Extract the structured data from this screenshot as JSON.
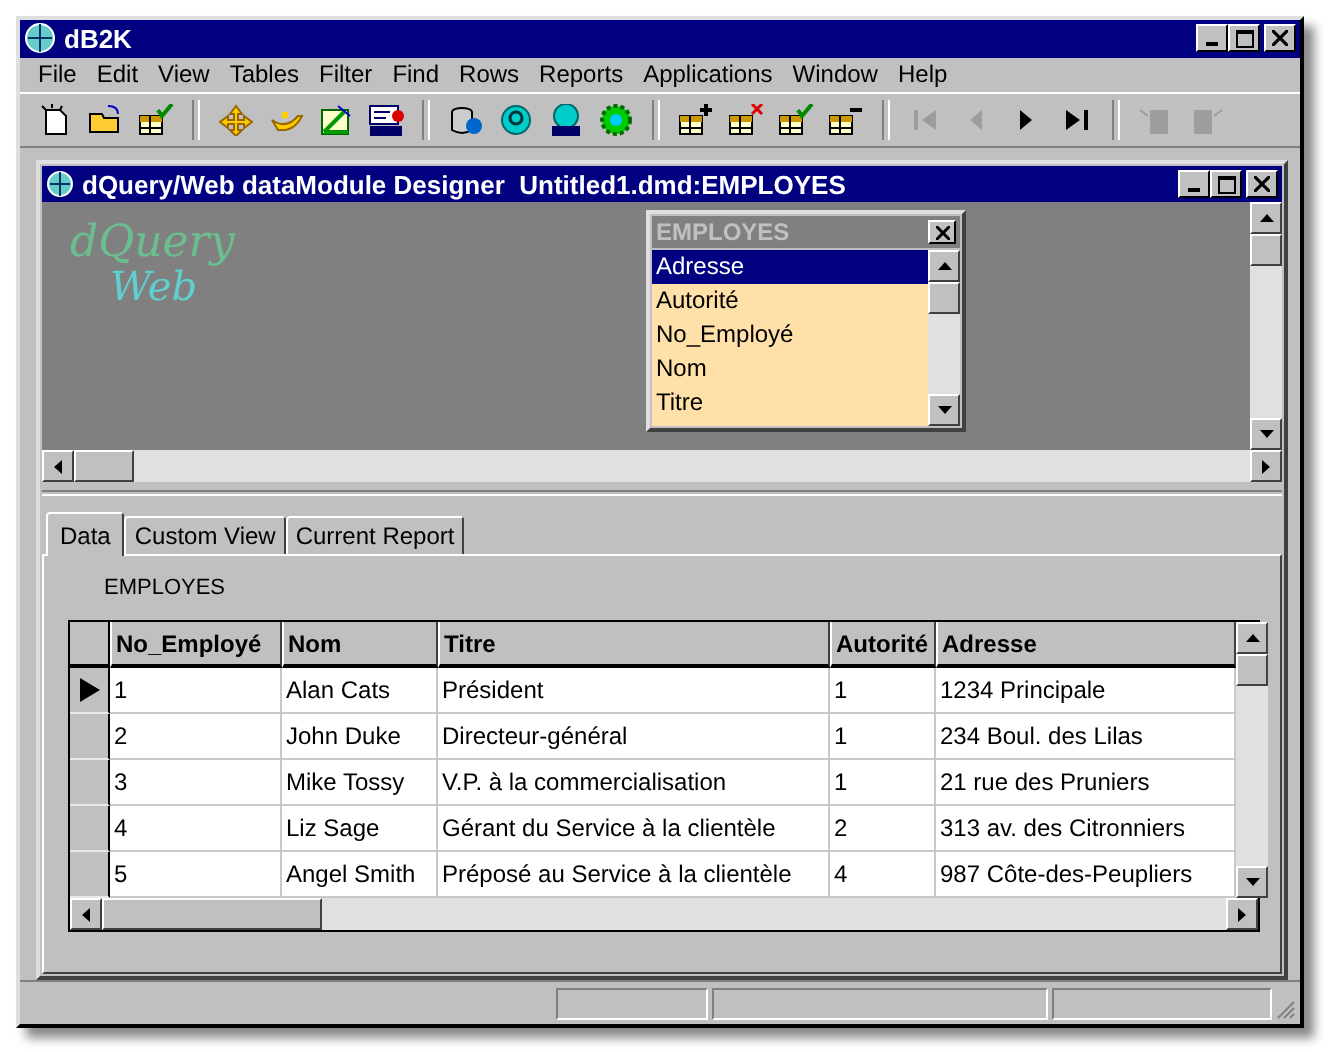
{
  "window": {
    "title": "dB2K"
  },
  "menu": [
    "File",
    "Edit",
    "View",
    "Tables",
    "Filter",
    "Find",
    "Rows",
    "Reports",
    "Applications",
    "Window",
    "Help"
  ],
  "toolbar": {
    "groups": [
      [
        {
          "disabled": false
        },
        {
          "disabled": false
        },
        {
          "disabled": false
        }
      ],
      [
        {
          "disabled": false
        },
        {
          "disabled": false
        },
        {
          "disabled": false
        },
        {
          "disabled": false
        }
      ],
      [
        {
          "disabled": false
        },
        {
          "disabled": false
        },
        {
          "disabled": false
        },
        {
          "disabled": false
        }
      ],
      [
        {
          "disabled": false
        },
        {
          "disabled": false
        },
        {
          "disabled": false
        },
        {
          "disabled": false
        }
      ],
      [
        {
          "disabled": true
        },
        {
          "disabled": true
        },
        {
          "disabled": false
        },
        {
          "disabled": false
        }
      ],
      [
        {
          "disabled": true
        },
        {
          "disabled": true
        }
      ]
    ]
  },
  "designer": {
    "title": "dQuery/Web dataModule Designer  Untitled1.dmd:EMPLOYES",
    "logo": [
      "dQuery",
      "Web"
    ],
    "field_list": {
      "title": "EMPLOYES",
      "items": [
        {
          "label": "Adresse",
          "selected": true
        },
        {
          "label": "Autorité",
          "selected": false
        },
        {
          "label": "No_Employé",
          "selected": false
        },
        {
          "label": "Nom",
          "selected": false
        },
        {
          "label": "Titre",
          "selected": false
        }
      ]
    },
    "tabs": [
      {
        "label": "Data",
        "selected": true
      },
      {
        "label": "Custom View",
        "selected": false
      },
      {
        "label": "Current Report",
        "selected": false
      }
    ],
    "table": {
      "caption": "EMPLOYES",
      "columns": [
        "No_Employé",
        "Nom",
        "Titre",
        "Autorité",
        "Adresse"
      ],
      "rows": [
        {
          "current": true,
          "cells": [
            "1",
            "Alan Cats",
            "Président",
            "1",
            "1234 Principale"
          ]
        },
        {
          "current": false,
          "cells": [
            "2",
            "John Duke",
            "Directeur-général",
            "1",
            "234 Boul. des Lilas"
          ]
        },
        {
          "current": false,
          "cells": [
            "3",
            "Mike Tossy",
            "V.P. à la commercialisation",
            "1",
            "21 rue des Pruniers"
          ]
        },
        {
          "current": false,
          "cells": [
            "4",
            "Liz Sage",
            "Gérant du Service à la clientèle",
            "2",
            "313 av. des Citronniers"
          ]
        },
        {
          "current": false,
          "cells": [
            "5",
            "Angel Smith",
            "Préposé au Service à la clientèle",
            "4",
            "987 Côte-des-Peupliers"
          ]
        }
      ]
    }
  }
}
